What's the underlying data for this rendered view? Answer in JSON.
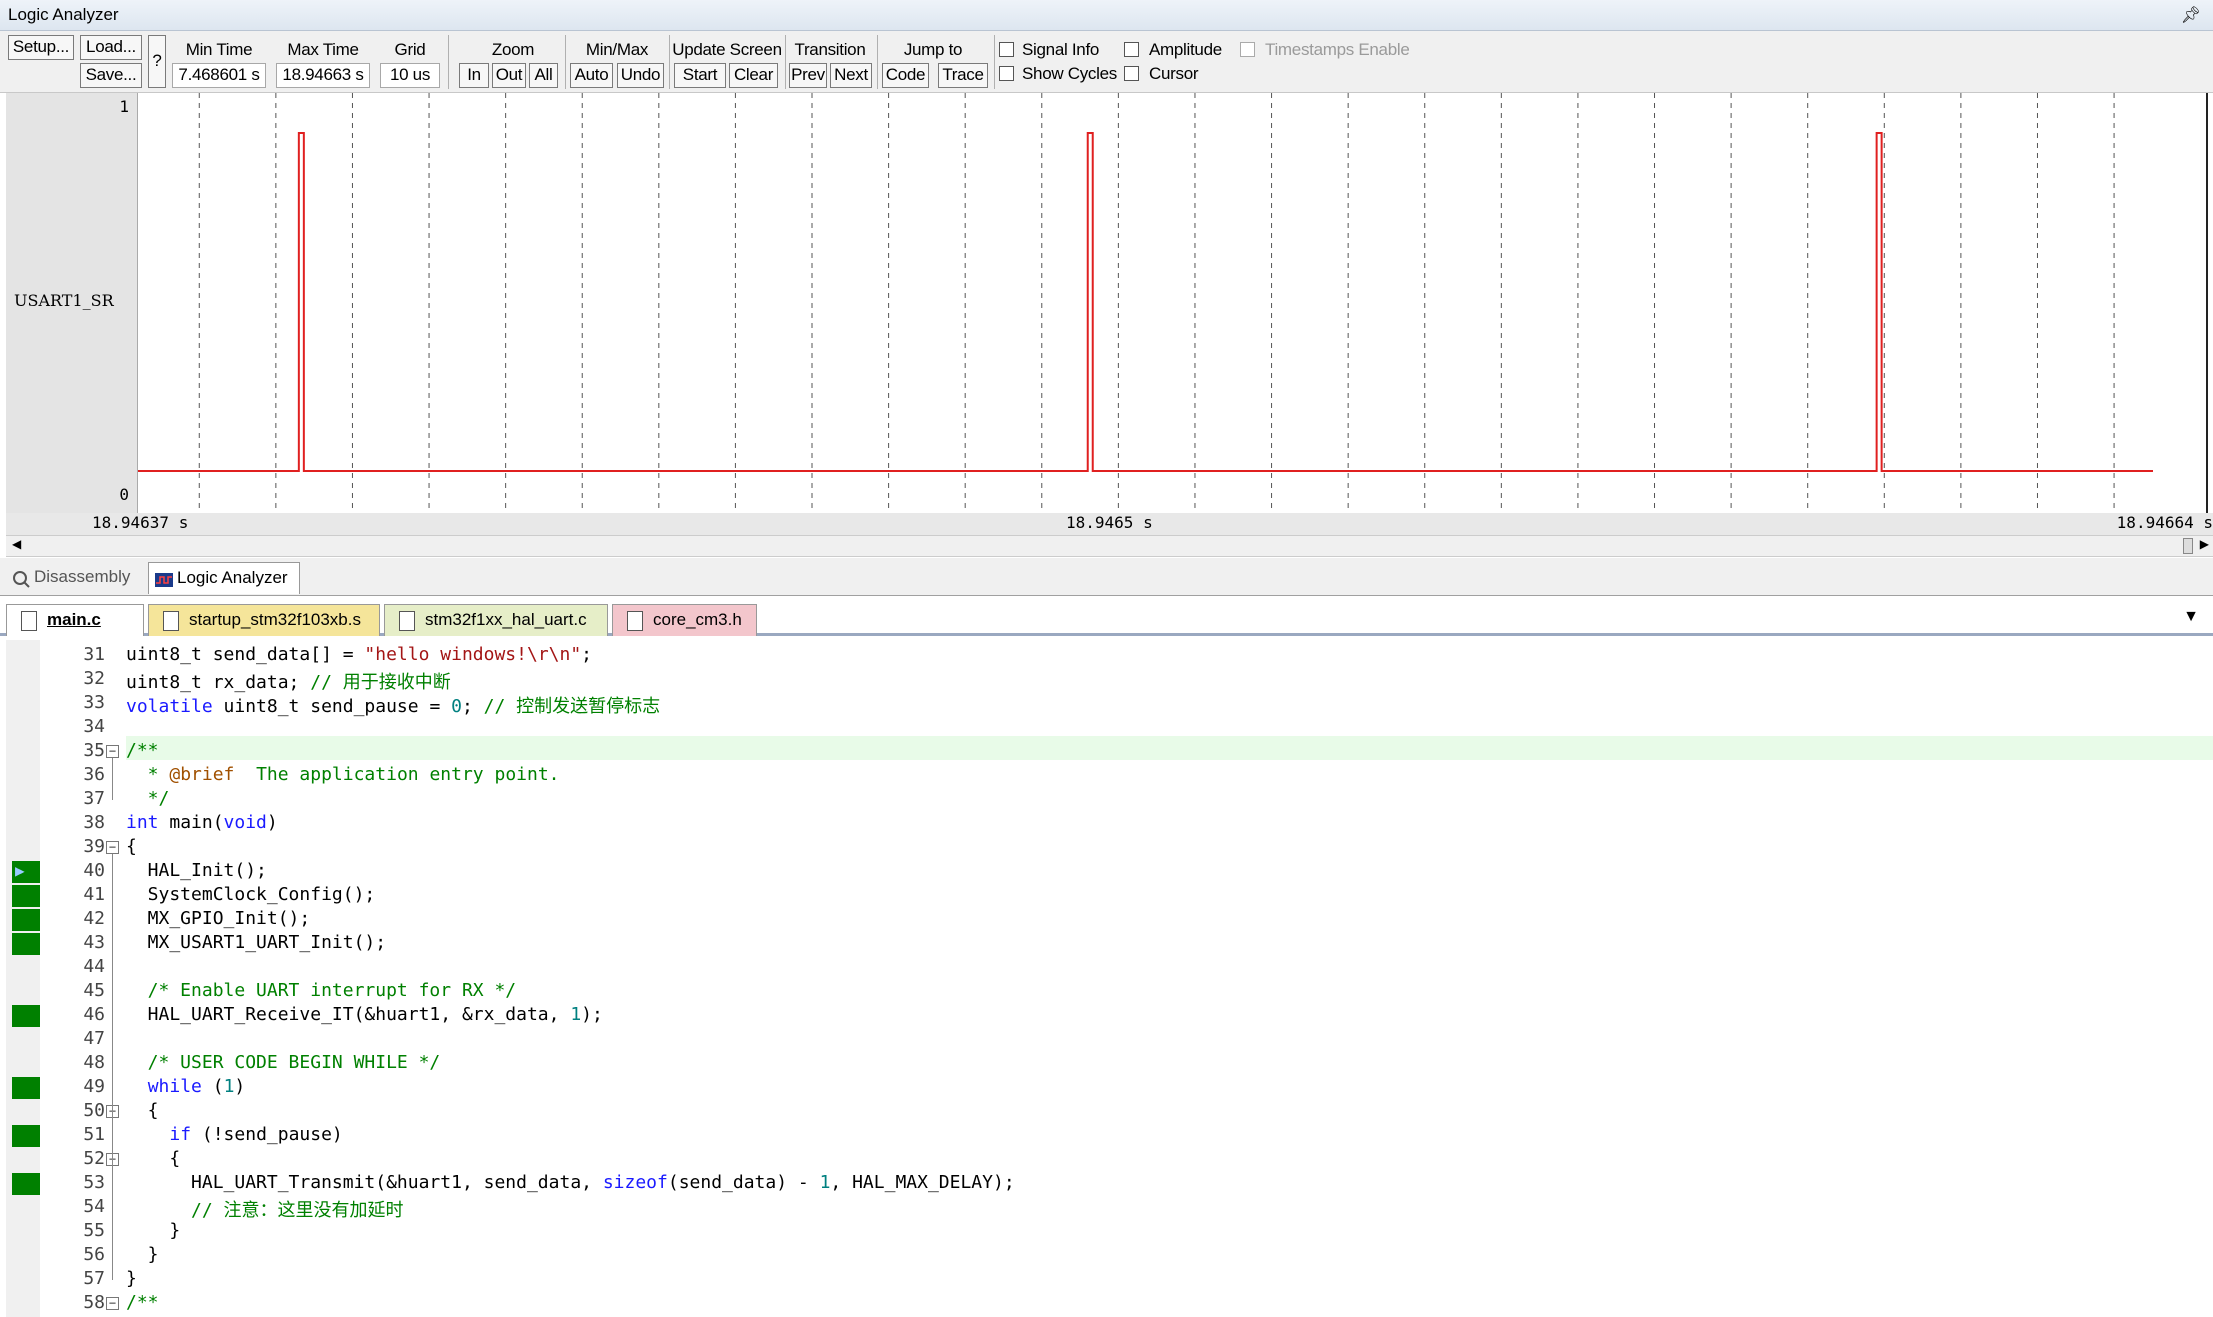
{
  "window": {
    "title": "Logic Analyzer",
    "pin_icon": "pin-icon"
  },
  "toolbar": {
    "setup": "Setup...",
    "load": "Load...",
    "save": "Save...",
    "help": "?",
    "min_time": {
      "label": "Min Time",
      "value": "7.468601 s"
    },
    "max_time": {
      "label": "Max Time",
      "value": "18.94663 s"
    },
    "grid": {
      "label": "Grid",
      "value": "10 us"
    },
    "zoom": {
      "label": "Zoom",
      "in": "In",
      "out": "Out",
      "all": "All"
    },
    "minmax": {
      "label": "Min/Max",
      "auto": "Auto",
      "undo": "Undo"
    },
    "update": {
      "label": "Update Screen",
      "start": "Start",
      "clear": "Clear"
    },
    "transition": {
      "label": "Transition",
      "prev": "Prev",
      "next": "Next"
    },
    "jump": {
      "label": "Jump to",
      "code": "Code",
      "trace": "Trace"
    },
    "checkboxes": {
      "signal_info": "Signal Info",
      "show_cycles": "Show Cycles",
      "amplitude": "Amplitude",
      "cursor": "Cursor",
      "timestamps": "Timestamps Enable"
    }
  },
  "graph": {
    "signal_name": "USART1_SR",
    "y_max": "1",
    "y_min": "0",
    "time_left": "18.94637  s",
    "time_mid": "18.9465  s",
    "time_right": "18.94664  s",
    "pulse_times": [
      18.946393,
      18.946496,
      18.946599
    ],
    "trace_color": "#e02020"
  },
  "bottom_tabs": {
    "disassembly": "Disassembly",
    "logic": "Logic Analyzer"
  },
  "file_tabs": [
    {
      "name": "main.c",
      "color": "#ffffff"
    },
    {
      "name": "startup_stm32f103xb.s",
      "color": "#f5e59a"
    },
    {
      "name": "stm32f1xx_hal_uart.c",
      "color": "#e6eec8"
    },
    {
      "name": "core_cm3.h",
      "color": "#f3c6cc"
    }
  ],
  "code": {
    "l31": "31",
    "l32": "32",
    "l33": "33",
    "l34": "34",
    "l35": "35",
    "l36": "36",
    "l37": "37",
    "l38": "38",
    "l39": "39",
    "l40": "40",
    "l41": "41",
    "l42": "42",
    "l43": "43",
    "l44": "44",
    "l45": "45",
    "l46": "46",
    "l47": "47",
    "l48": "48",
    "l49": "49",
    "l50": "50",
    "l51": "51",
    "l52": "52",
    "l53": "53",
    "l54": "54",
    "l55": "55",
    "l56": "56",
    "l57": "57",
    "l58": "58",
    "c31a": "uint8_t send_data[] = ",
    "c31b": "\"hello windows!\\r\\n\"",
    "c31c": ";",
    "c32a": "uint8_t rx_data; ",
    "c32b": "// 用于接收中断",
    "c33a": "volatile",
    "c33b": " uint8_t send_pause = ",
    "c33c": "0",
    "c33d": "; ",
    "c33e": "// 控制发送暂停标志",
    "c35": "/**",
    "c36a": "  * ",
    "c36b": "@brief",
    "c36c": "  The application entry point.",
    "c37": "  */",
    "c38a": "int",
    "c38b": " main(",
    "c38c": "void",
    "c38d": ")",
    "c39": "{",
    "c40": "  HAL_Init();",
    "c41": "  SystemClock_Config();",
    "c42": "  MX_GPIO_Init();",
    "c43": "  MX_USART1_UART_Init();",
    "c45": "  /* Enable UART interrupt for RX */",
    "c46a": "  HAL_UART_Receive_IT(&huart1, &rx_data, ",
    "c46b": "1",
    "c46c": ");",
    "c48": "  /* USER CODE BEGIN WHILE */",
    "c49a": "  ",
    "c49b": "while",
    "c49c": " (",
    "c49d": "1",
    "c49e": ")",
    "c50": "  {",
    "c51a": "    ",
    "c51b": "if",
    "c51c": " (!send_pause)",
    "c52": "    {",
    "c53a": "      HAL_UART_Transmit(&huart1, send_data, ",
    "c53b": "sizeof",
    "c53c": "(send_data) - ",
    "c53d": "1",
    "c53e": ", HAL_MAX_DELAY);",
    "c54": "      // 注意：这里没有加延时",
    "c55": "    }",
    "c56": "  }",
    "c57": "}",
    "c58": "/**"
  }
}
